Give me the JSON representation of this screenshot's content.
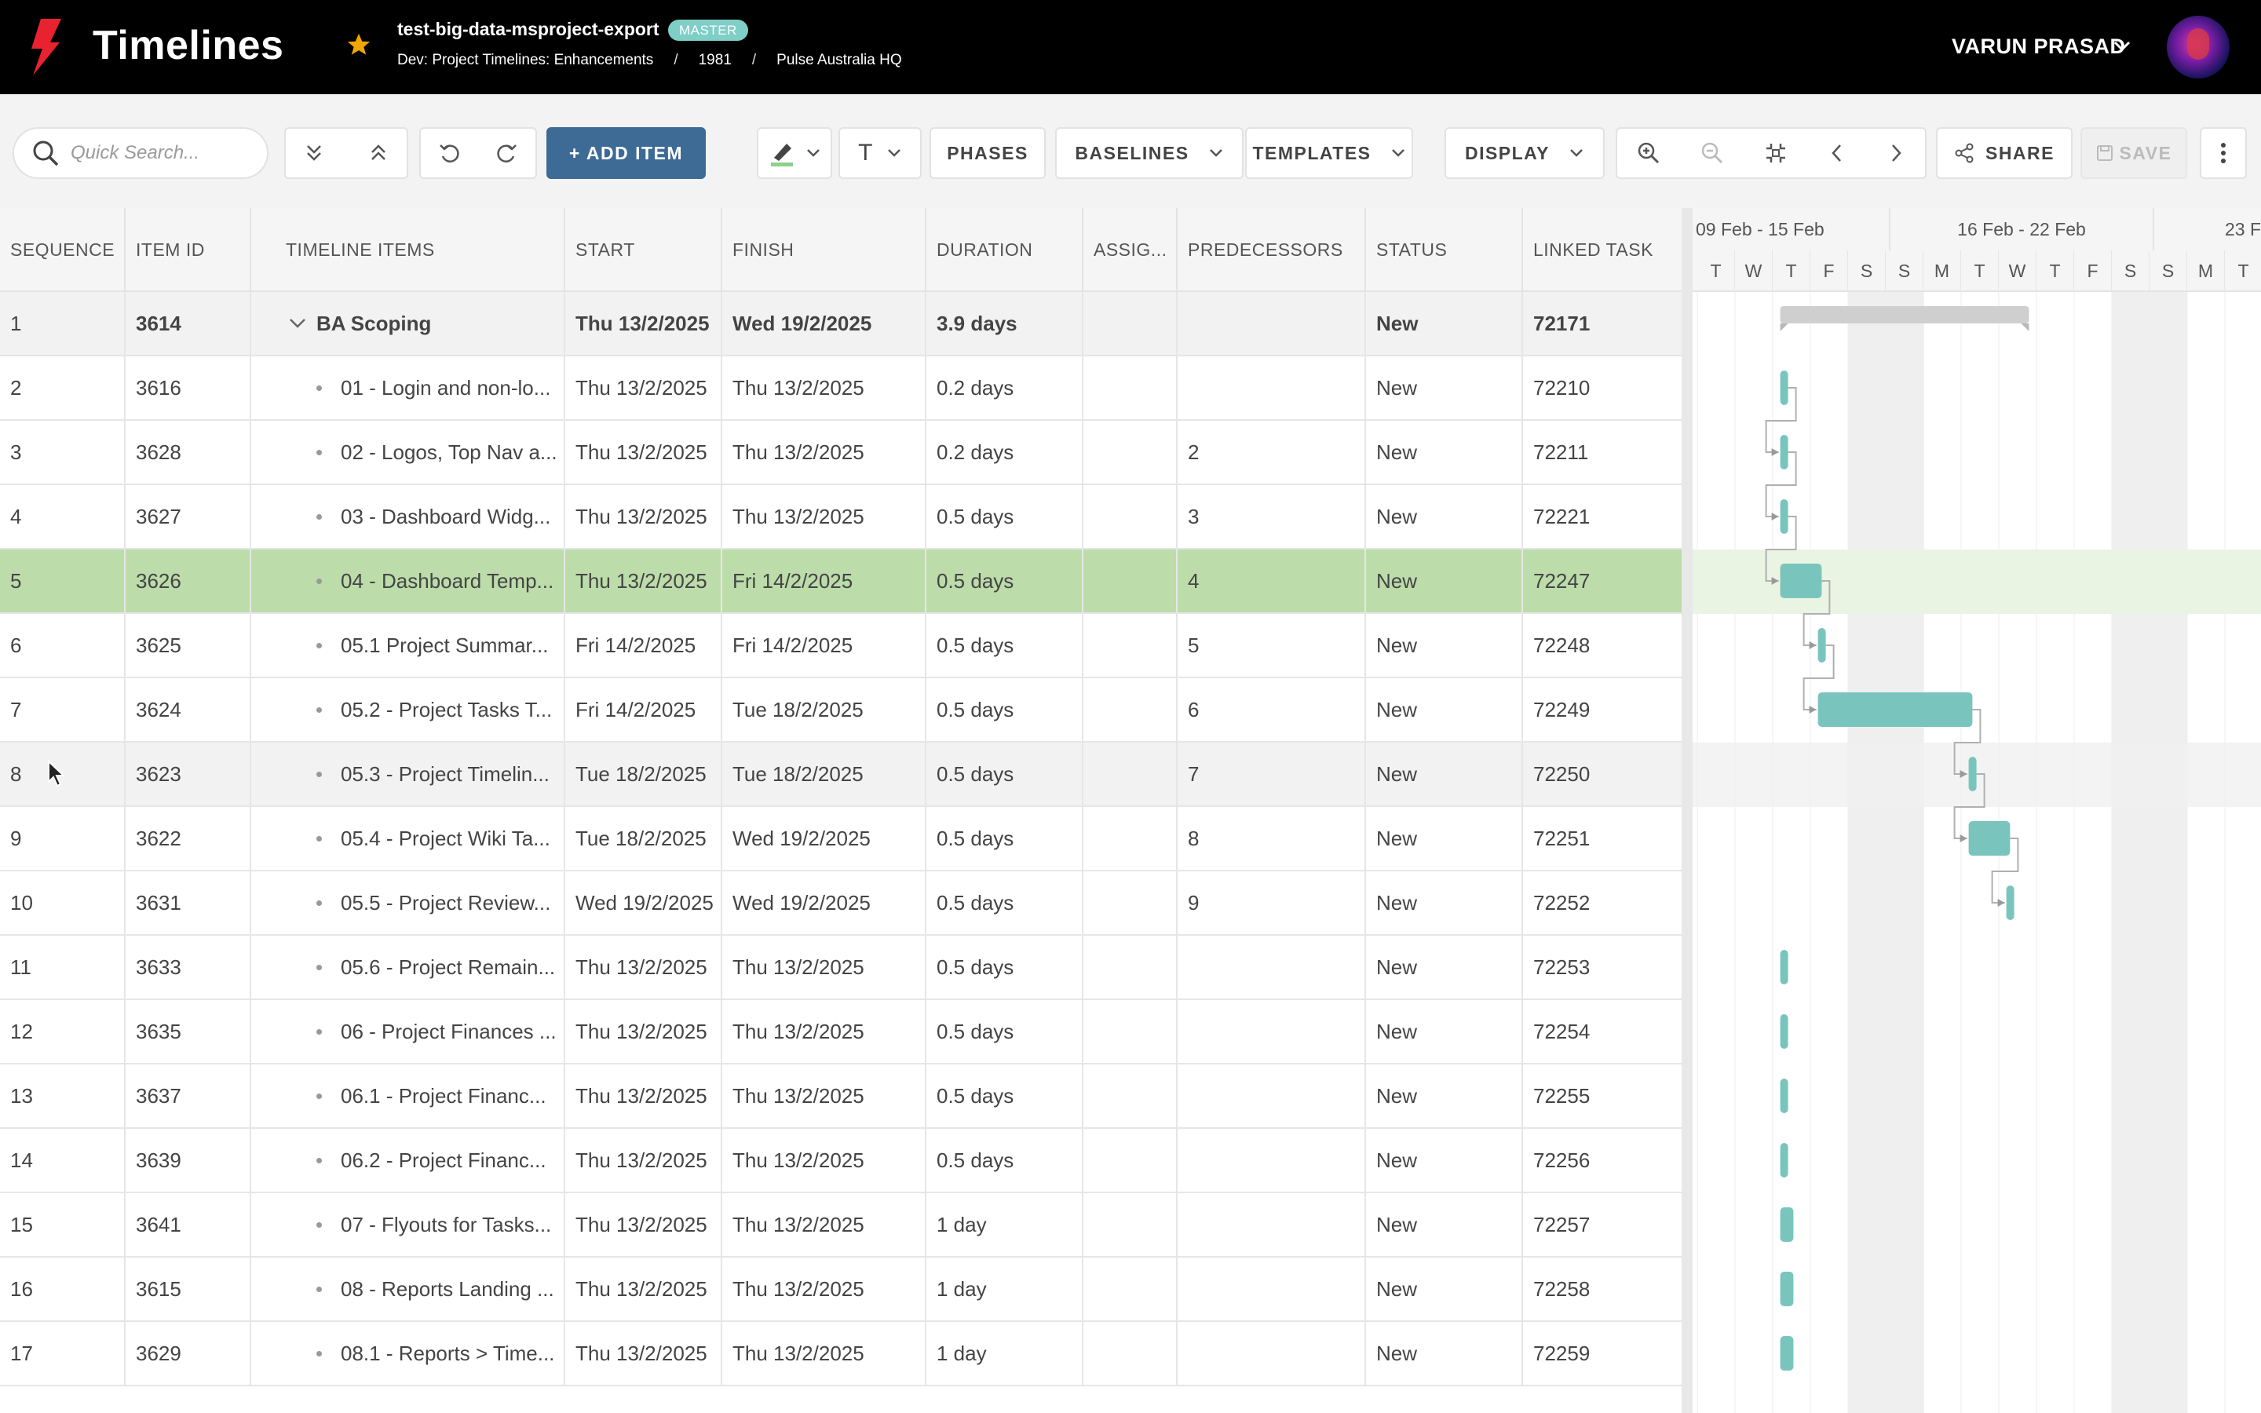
{
  "header": {
    "app_title": "Timelines",
    "project_name": "test-big-data-msproject-export",
    "badge": "MASTER",
    "breadcrumbs": [
      "Dev: Project Timelines: Enhancements",
      "1981",
      "Pulse Australia HQ"
    ],
    "user_name": "VARUN PRASAD",
    "colors": {
      "background": "#000000",
      "logo": "#e8232f",
      "star": "#f0a500",
      "badge": "#7fcfc7"
    }
  },
  "toolbar": {
    "search_placeholder": "Quick Search...",
    "add_item": "+ ADD ITEM",
    "phases": "PHASES",
    "baselines": "BASELINES",
    "templates": "TEMPLATES",
    "display": "DISPLAY",
    "share": "SHARE",
    "save": "SAVE",
    "text_format": "T",
    "accent": "#3d6b96"
  },
  "grid": {
    "columns": [
      "SEQUENCE",
      "ITEM ID",
      "TIMELINE ITEMS",
      "START",
      "FINISH",
      "DURATION",
      "ASSIG...",
      "PREDECESSORS",
      "STATUS",
      "LINKED TASK"
    ],
    "rows": [
      {
        "seq": "1",
        "id": "3614",
        "name": "BA Scoping",
        "start": "Thu 13/2/2025",
        "finish": "Wed 19/2/2025",
        "duration": "3.9 days",
        "assig": "",
        "pred": "",
        "status": "New",
        "linked": "72171",
        "parent": true
      },
      {
        "seq": "2",
        "id": "3616",
        "name": "01 - Login and non-lo...",
        "start": "Thu 13/2/2025",
        "finish": "Thu 13/2/2025",
        "duration": "0.2 days",
        "assig": "",
        "pred": "",
        "status": "New",
        "linked": "72210"
      },
      {
        "seq": "3",
        "id": "3628",
        "name": "02 - Logos, Top Nav a...",
        "start": "Thu 13/2/2025",
        "finish": "Thu 13/2/2025",
        "duration": "0.2 days",
        "assig": "",
        "pred": "2",
        "status": "New",
        "linked": "72211"
      },
      {
        "seq": "4",
        "id": "3627",
        "name": "03 - Dashboard Widg...",
        "start": "Thu 13/2/2025",
        "finish": "Thu 13/2/2025",
        "duration": "0.5 days",
        "assig": "",
        "pred": "3",
        "status": "New",
        "linked": "72221"
      },
      {
        "seq": "5",
        "id": "3626",
        "name": "04 - Dashboard Temp...",
        "start": "Thu 13/2/2025",
        "finish": "Fri 14/2/2025",
        "duration": "0.5 days",
        "assig": "",
        "pred": "4",
        "status": "New",
        "linked": "72247",
        "selected": true
      },
      {
        "seq": "6",
        "id": "3625",
        "name": "05.1 Project Summar...",
        "start": "Fri 14/2/2025",
        "finish": "Fri 14/2/2025",
        "duration": "0.5 days",
        "assig": "",
        "pred": "5",
        "status": "New",
        "linked": "72248"
      },
      {
        "seq": "7",
        "id": "3624",
        "name": "05.2 - Project Tasks T...",
        "start": "Fri 14/2/2025",
        "finish": "Tue 18/2/2025",
        "duration": "0.5 days",
        "assig": "",
        "pred": "6",
        "status": "New",
        "linked": "72249"
      },
      {
        "seq": "8",
        "id": "3623",
        "name": "05.3 - Project Timelin...",
        "start": "Tue 18/2/2025",
        "finish": "Tue 18/2/2025",
        "duration": "0.5 days",
        "assig": "",
        "pred": "7",
        "status": "New",
        "linked": "72250",
        "hover": true
      },
      {
        "seq": "9",
        "id": "3622",
        "name": "05.4 - Project Wiki Ta...",
        "start": "Tue 18/2/2025",
        "finish": "Wed 19/2/2025",
        "duration": "0.5 days",
        "assig": "",
        "pred": "8",
        "status": "New",
        "linked": "72251"
      },
      {
        "seq": "10",
        "id": "3631",
        "name": "05.5 - Project Review...",
        "start": "Wed 19/2/2025",
        "finish": "Wed 19/2/2025",
        "duration": "0.5 days",
        "assig": "",
        "pred": "9",
        "status": "New",
        "linked": "72252"
      },
      {
        "seq": "11",
        "id": "3633",
        "name": "05.6 - Project Remain...",
        "start": "Thu 13/2/2025",
        "finish": "Thu 13/2/2025",
        "duration": "0.5 days",
        "assig": "",
        "pred": "",
        "status": "New",
        "linked": "72253"
      },
      {
        "seq": "12",
        "id": "3635",
        "name": "06 - Project Finances ...",
        "start": "Thu 13/2/2025",
        "finish": "Thu 13/2/2025",
        "duration": "0.5 days",
        "assig": "",
        "pred": "",
        "status": "New",
        "linked": "72254"
      },
      {
        "seq": "13",
        "id": "3637",
        "name": "06.1 - Project Financ...",
        "start": "Thu 13/2/2025",
        "finish": "Thu 13/2/2025",
        "duration": "0.5 days",
        "assig": "",
        "pred": "",
        "status": "New",
        "linked": "72255"
      },
      {
        "seq": "14",
        "id": "3639",
        "name": "06.2 - Project Financ...",
        "start": "Thu 13/2/2025",
        "finish": "Thu 13/2/2025",
        "duration": "0.5 days",
        "assig": "",
        "pred": "",
        "status": "New",
        "linked": "72256"
      },
      {
        "seq": "15",
        "id": "3641",
        "name": "07 - Flyouts for Tasks...",
        "start": "Thu 13/2/2025",
        "finish": "Thu 13/2/2025",
        "duration": "1 day",
        "assig": "",
        "pred": "",
        "status": "New",
        "linked": "72257"
      },
      {
        "seq": "16",
        "id": "3615",
        "name": "08 - Reports Landing ...",
        "start": "Thu 13/2/2025",
        "finish": "Thu 13/2/2025",
        "duration": "1 day",
        "assig": "",
        "pred": "",
        "status": "New",
        "linked": "72258"
      },
      {
        "seq": "17",
        "id": "3629",
        "name": "08.1 - Reports > Time...",
        "start": "Thu 13/2/2025",
        "finish": "Thu 13/2/2025",
        "duration": "1 day",
        "assig": "",
        "pred": "",
        "status": "New",
        "linked": "72259"
      }
    ],
    "colors": {
      "selected_row": "#bcdcaa",
      "hover_row": "#f2f2f2"
    }
  },
  "gantt": {
    "weeks": [
      "09 Feb - 15 Feb",
      "16 Feb - 22 Feb",
      "23 Fe"
    ],
    "days": [
      "T",
      "W",
      "T",
      "F",
      "S",
      "S",
      "M",
      "T",
      "W",
      "T",
      "F",
      "S",
      "S",
      "M",
      "T"
    ],
    "bar_color": "#79c5bd",
    "summary_bar_color": "#cfcfcf"
  }
}
